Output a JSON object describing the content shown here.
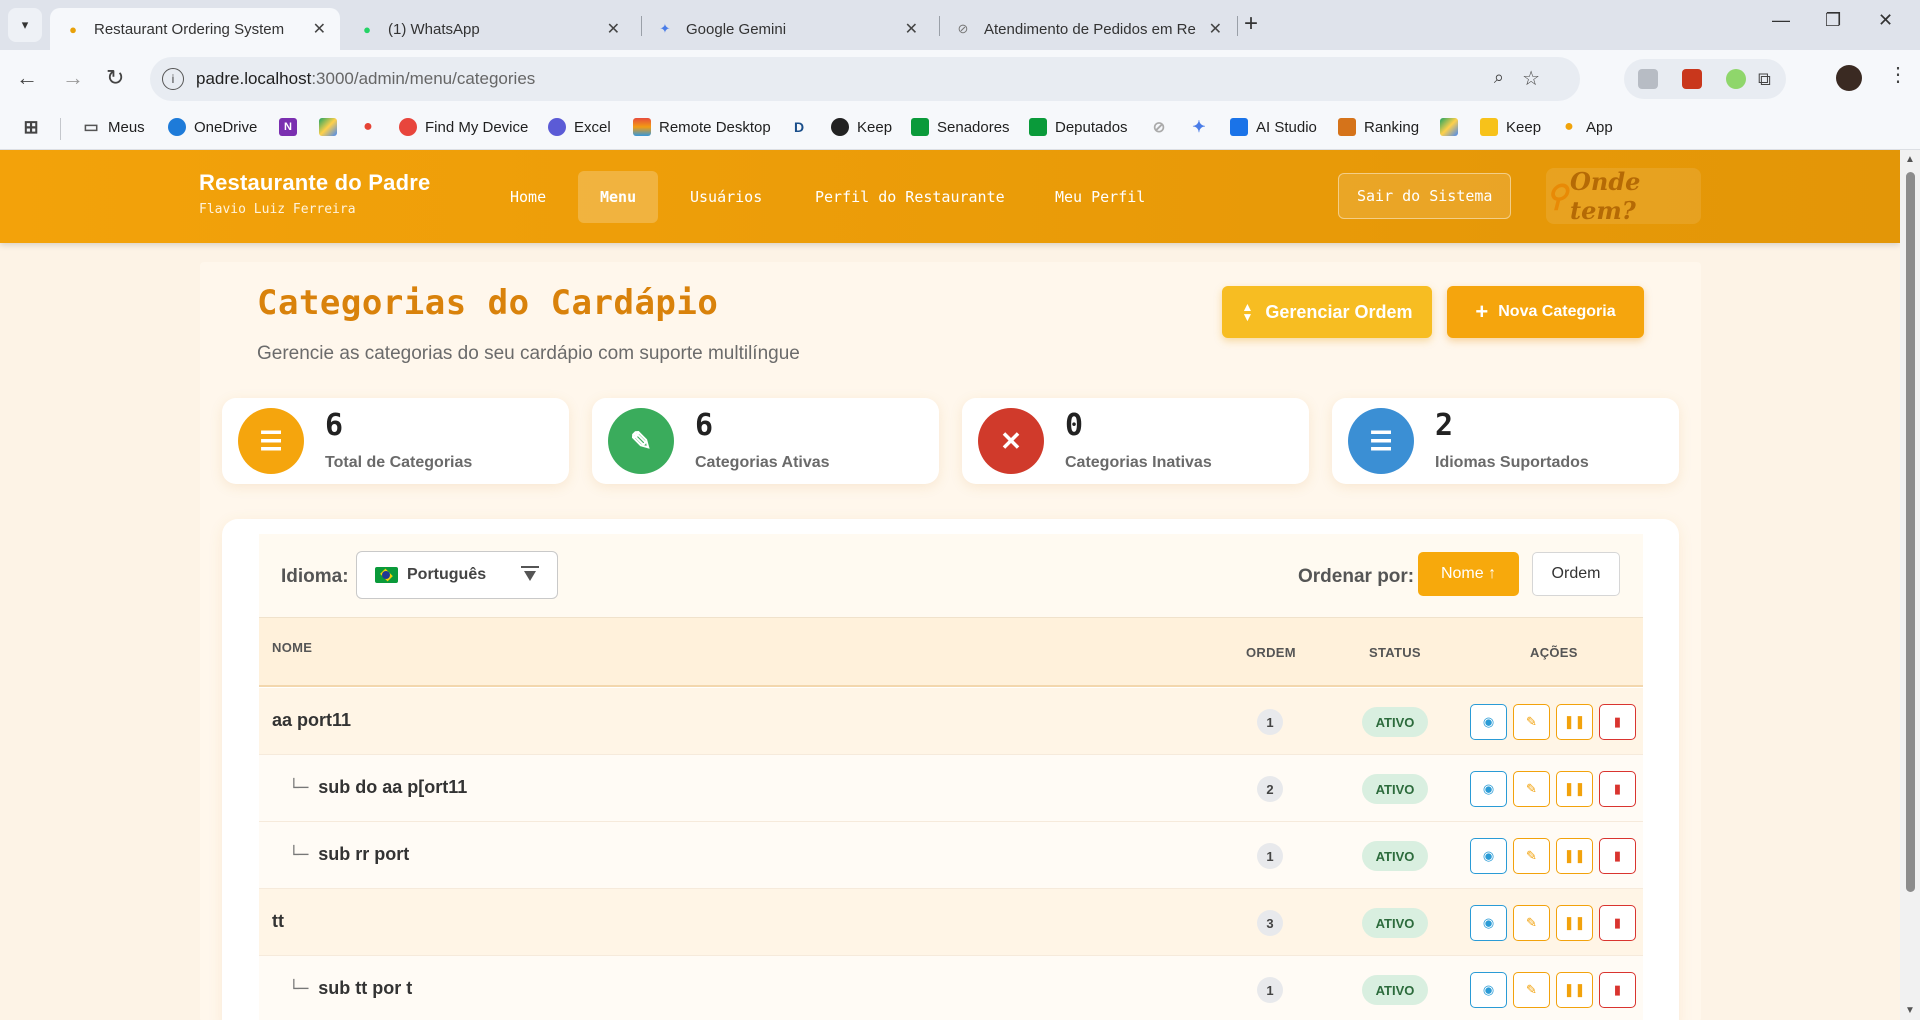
{
  "browser": {
    "tabs": [
      {
        "title": "Restaurant Ordering System",
        "active": true
      },
      {
        "title": "(1) WhatsApp",
        "active": false
      },
      {
        "title": "Google Gemini",
        "active": false
      },
      {
        "title": "Atendimento de Pedidos em Re",
        "active": false
      }
    ],
    "url_host": "padre.localhost",
    "url_rest": ":3000/admin/menu/categories",
    "bookmarks": [
      {
        "label": "Meus",
        "icon": "folder-icon"
      },
      {
        "label": "OneDrive",
        "icon": "onedrive-icon"
      },
      {
        "label": "",
        "icon": "onenote-icon"
      },
      {
        "label": "",
        "icon": "drive-icon"
      },
      {
        "label": "",
        "icon": "maps-icon"
      },
      {
        "label": "Find My Device",
        "icon": "find-device-icon"
      },
      {
        "label": "Excel",
        "icon": "excel-icon"
      },
      {
        "label": "Remote Desktop",
        "icon": "remote-desktop-icon"
      },
      {
        "label": "",
        "icon": "disney-icon"
      },
      {
        "label": "Keep",
        "icon": "globe-icon"
      },
      {
        "label": "Senadores",
        "icon": "brazil-flag-icon"
      },
      {
        "label": "Deputados",
        "icon": "brazil-flag-icon"
      },
      {
        "label": "",
        "icon": "spinner-icon"
      },
      {
        "label": "",
        "icon": "gemini-icon"
      },
      {
        "label": "AI Studio",
        "icon": "ai-studio-icon"
      },
      {
        "label": "Ranking",
        "icon": "ranking-icon"
      },
      {
        "label": "",
        "icon": "drive-icon"
      },
      {
        "label": "Keep",
        "icon": "keep-icon"
      },
      {
        "label": "App",
        "icon": "maps-icon"
      }
    ]
  },
  "nav": {
    "brand": "Restaurante do Padre",
    "user": "Flavio Luiz Ferreira",
    "links": [
      "Home",
      "Menu",
      "Usuários",
      "Perfil do Restaurante",
      "Meu Perfil"
    ],
    "active_link": "Menu",
    "logout": "Sair do Sistema",
    "logo_text": "Onde tem?"
  },
  "header": {
    "title": "Categorias do Cardápio",
    "subtitle": "Gerencie as categorias do seu cardápio com suporte multilíngue",
    "manage_order": "Gerenciar Ordem",
    "new_category": "Nova Categoria"
  },
  "stats": [
    {
      "value": "6",
      "label": "Total de Categorias",
      "color": "#f5a50d",
      "icon": "list-icon"
    },
    {
      "value": "6",
      "label": "Categorias Ativas",
      "color": "#3aac5c",
      "icon": "edit-icon"
    },
    {
      "value": "0",
      "label": "Categorias Inativas",
      "color": "#d03a2b",
      "icon": "close-icon"
    },
    {
      "value": "2",
      "label": "Idiomas Suportados",
      "color": "#3b8fd4",
      "icon": "list-icon"
    }
  ],
  "filters": {
    "language_label": "Idioma:",
    "language_value": "Português",
    "sort_label": "Ordenar por:",
    "sort_name": "Nome ↑",
    "sort_order": "Ordem"
  },
  "table": {
    "headers": {
      "name": "NOME",
      "order": "ORDEM",
      "status": "STATUS",
      "actions": "AÇÕES"
    },
    "rows": [
      {
        "name": "aa port11",
        "level": 0,
        "order": "1",
        "status": "ATIVO"
      },
      {
        "name": "sub do aa p[ort11",
        "level": 1,
        "order": "2",
        "status": "ATIVO"
      },
      {
        "name": "sub rr port",
        "level": 1,
        "order": "1",
        "status": "ATIVO"
      },
      {
        "name": "tt",
        "level": 0,
        "order": "3",
        "status": "ATIVO"
      },
      {
        "name": "sub tt por t",
        "level": 1,
        "order": "1",
        "status": "ATIVO"
      }
    ],
    "branch_glyph": "└─"
  }
}
